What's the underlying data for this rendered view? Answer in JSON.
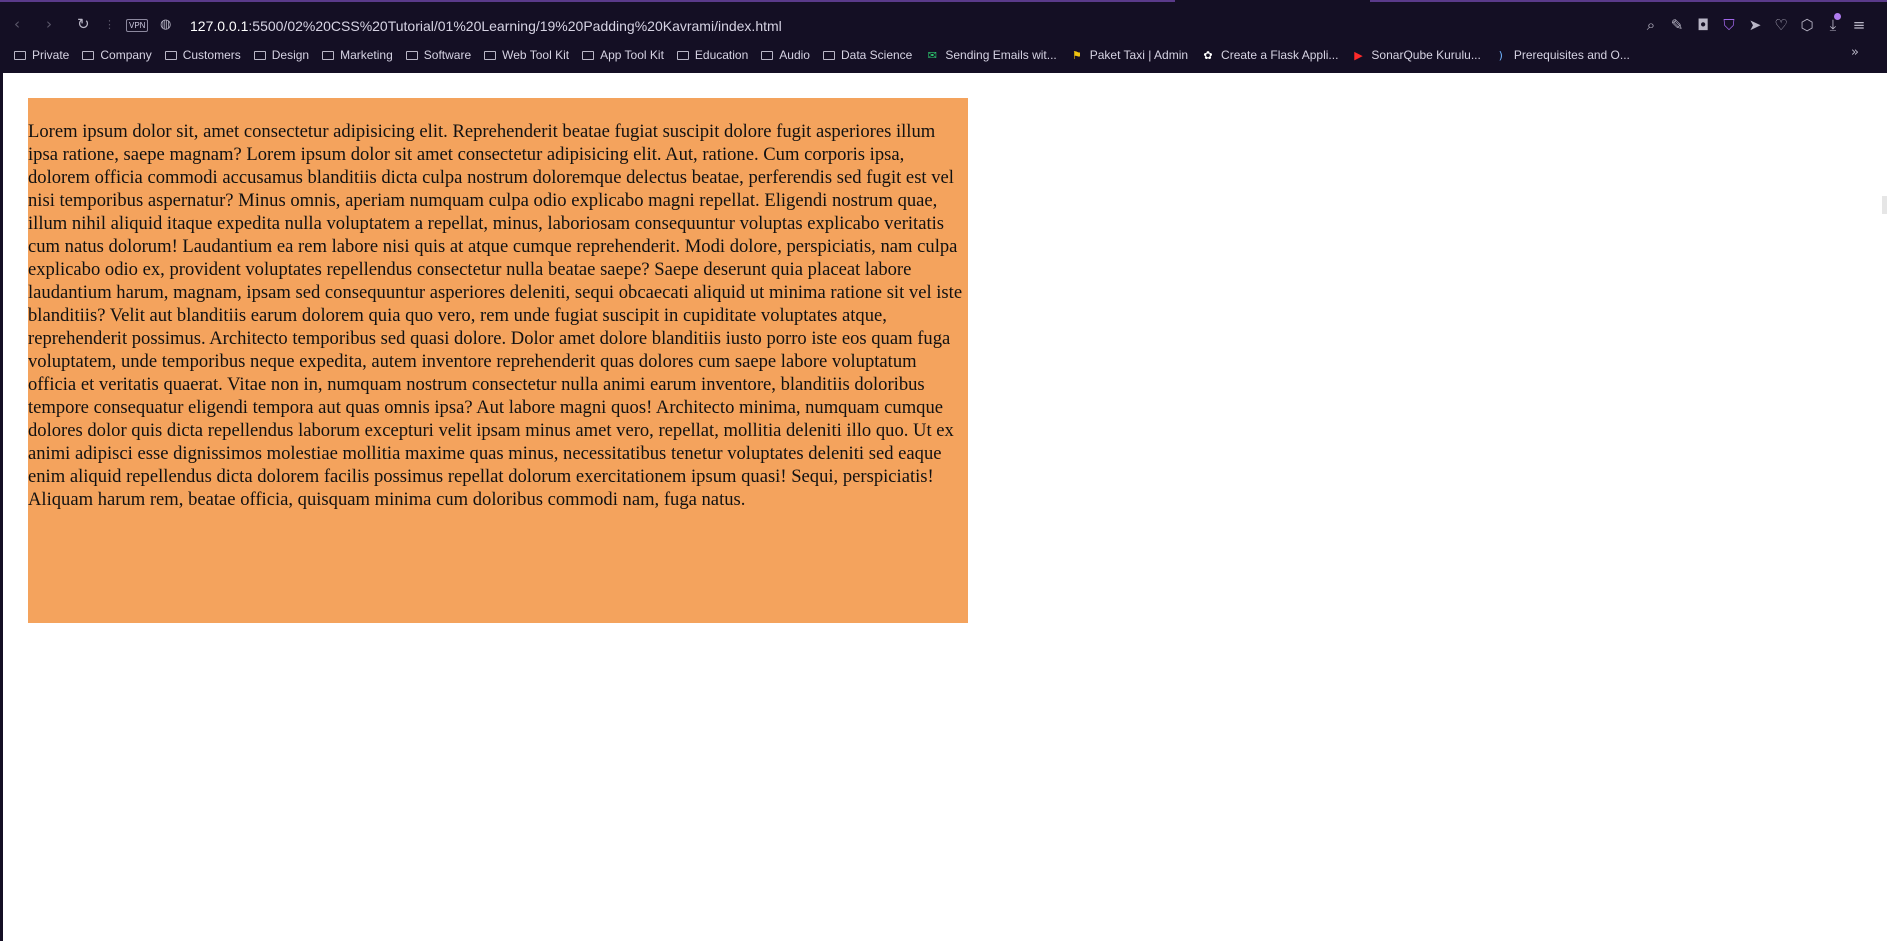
{
  "browser": {
    "url_host": "127.0.0.1",
    "url_rest": ":5500/02%20CSS%20Tutorial/01%20Learning/19%20Padding%20Kavrami/index.html",
    "vpn_label": "VPN",
    "bookmarks": [
      {
        "label": "Private",
        "icon": "folder-icon"
      },
      {
        "label": "Company",
        "icon": "folder-icon"
      },
      {
        "label": "Customers",
        "icon": "folder-icon"
      },
      {
        "label": "Design",
        "icon": "folder-icon"
      },
      {
        "label": "Marketing",
        "icon": "folder-icon"
      },
      {
        "label": "Software",
        "icon": "folder-icon"
      },
      {
        "label": "Web Tool Kit",
        "icon": "folder-icon"
      },
      {
        "label": "App Tool Kit",
        "icon": "folder-icon"
      },
      {
        "label": "Education",
        "icon": "folder-icon"
      },
      {
        "label": "Audio",
        "icon": "folder-icon"
      },
      {
        "label": "Data Science",
        "icon": "folder-icon"
      },
      {
        "label": "Sending Emails wit...",
        "icon": "mail-icon"
      },
      {
        "label": "Paket Taxi | Admin",
        "icon": "taxi-icon"
      },
      {
        "label": "Create a Flask Appli...",
        "icon": "flask-icon"
      },
      {
        "label": "SonarQube Kurulu...",
        "icon": "youtube-icon"
      },
      {
        "label": "Prerequisites and O...",
        "icon": "sonar-icon"
      }
    ]
  },
  "page": {
    "paragraph": "Lorem ipsum dolor sit, amet consectetur adipisicing elit. Reprehenderit beatae fugiat suscipit dolore fugit asperiores illum ipsa ratione, saepe magnam? Lorem ipsum dolor sit amet consectetur adipisicing elit. Aut, ratione. Cum corporis ipsa, dolorem officia commodi accusamus blanditiis dicta culpa nostrum doloremque delectus beatae, perferendis sed fugit est vel nisi temporibus aspernatur? Minus omnis, aperiam numquam culpa odio explicabo magni repellat. Eligendi nostrum quae, illum nihil aliquid itaque expedita nulla voluptatem a repellat, minus, laboriosam consequuntur voluptas explicabo veritatis cum natus dolorum! Laudantium ea rem labore nisi quis at atque cumque reprehenderit. Modi dolore, perspiciatis, nam culpa explicabo odio ex, provident voluptates repellendus consectetur nulla beatae saepe? Saepe deserunt quia placeat labore laudantium harum, magnam, ipsam sed consequuntur asperiores deleniti, sequi obcaecati aliquid ut minima ratione sit vel iste blanditiis? Velit aut blanditiis earum dolorem quia quo vero, rem unde fugiat suscipit in cupiditate voluptates atque, reprehenderit possimus. Architecto temporibus sed quasi dolore. Dolor amet dolore blanditiis iusto porro iste eos quam fuga voluptatem, unde temporibus neque expedita, autem inventore reprehenderit quas dolores cum saepe labore voluptatum officia et veritatis quaerat. Vitae non in, numquam nostrum consectetur nulla animi earum inventore, blanditiis doloribus tempore consequatur eligendi tempora aut quas omnis ipsa? Aut labore magni quos! Architecto minima, numquam cumque dolores dolor quis dicta repellendus laborum excepturi velit ipsam minus amet vero, repellat, mollitia deleniti illo quo. Ut ex animi adipisci esse dignissimos molestiae mollitia maxime quas minus, necessitatibus tenetur voluptates deleniti sed eaque enim aliquid repellendus dicta dolorem facilis possimus repellat dolorum exercitationem ipsum quasi! Sequi, perspiciatis! Aliquam harum rem, beatae officia, quisquam minima cum doloribus commodi nam, fuga natus.",
    "box_color": "#f4a35d"
  }
}
